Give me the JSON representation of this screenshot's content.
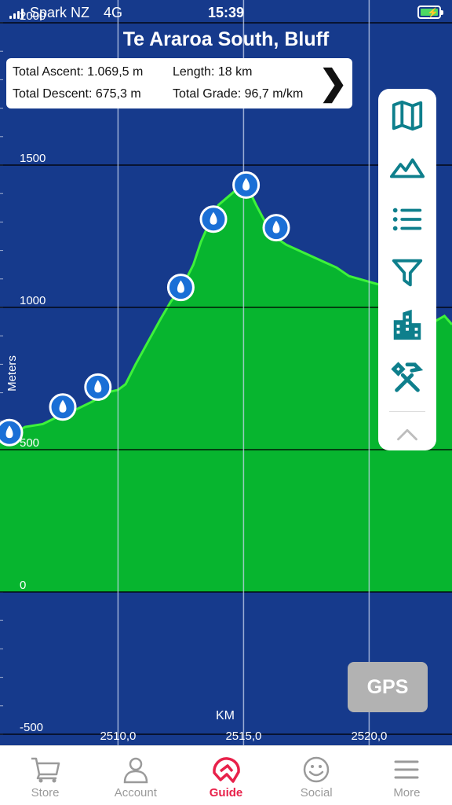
{
  "status": {
    "carrier": "Spark NZ",
    "network": "4G",
    "time": "15:39"
  },
  "title": "Te Araroa South, Bluff",
  "stats": {
    "ascent": "Total Ascent: 1.069,5 m",
    "length": "Length: 18 km",
    "descent": "Total Descent: 675,3 m",
    "grade": "Total Grade: 96,7 m/km",
    "more_icon": "chevron-right-icon"
  },
  "toolbar": {
    "items": [
      {
        "name": "map-icon"
      },
      {
        "name": "elevation-icon"
      },
      {
        "name": "list-icon"
      },
      {
        "name": "filter-icon"
      },
      {
        "name": "buildings-icon"
      },
      {
        "name": "tools-icon"
      },
      {
        "name": "collapse-icon"
      }
    ]
  },
  "gps_label": "GPS",
  "tabs": [
    {
      "label": "Store",
      "icon": "cart-icon"
    },
    {
      "label": "Account",
      "icon": "person-icon"
    },
    {
      "label": "Guide",
      "icon": "guide-icon",
      "active": true
    },
    {
      "label": "Social",
      "icon": "smiley-icon"
    },
    {
      "label": "More",
      "icon": "menu-icon"
    }
  ],
  "colors": {
    "background": "#163a8c",
    "fill": "#07b52f",
    "line": "#3ef23a",
    "accent": "#0e7f8c",
    "marker": "#1a6fd6",
    "active_tab": "#e8214a"
  },
  "chart_data": {
    "type": "area",
    "xlabel": "KM",
    "ylabel": "Meters",
    "ylim": [
      -500,
      2000
    ],
    "xlim": [
      2505.3,
      2523.3
    ],
    "yticks": [
      -500,
      0,
      500,
      1000,
      1500,
      2000
    ],
    "ytick_labels": [
      "-500",
      "0",
      "500",
      "1000",
      "1500",
      "2000"
    ],
    "xticks": [
      2510,
      2515,
      2520
    ],
    "xtick_labels": [
      "2510,0",
      "2515,0",
      "2520,0"
    ],
    "grid": true,
    "x": [
      2505.3,
      2505.7,
      2506.3,
      2507.0,
      2507.7,
      2508.3,
      2509.0,
      2509.5,
      2510.0,
      2510.3,
      2510.7,
      2511.2,
      2511.7,
      2512.1,
      2512.6,
      2513.0,
      2513.3,
      2513.6,
      2514.0,
      2514.4,
      2514.8,
      2515.2,
      2515.5,
      2515.8,
      2516.2,
      2516.7,
      2517.2,
      2517.7,
      2518.2,
      2518.7,
      2519.2,
      2519.6,
      2520.0,
      2520.4,
      2520.8,
      2521.2,
      2521.7,
      2522.2,
      2522.6,
      2523.0,
      2523.3
    ],
    "y": [
      540,
      550,
      580,
      590,
      620,
      640,
      670,
      700,
      710,
      730,
      800,
      880,
      960,
      1020,
      1080,
      1150,
      1230,
      1290,
      1360,
      1390,
      1420,
      1415,
      1360,
      1310,
      1250,
      1220,
      1200,
      1180,
      1160,
      1140,
      1110,
      1100,
      1090,
      1080,
      1050,
      1010,
      980,
      960,
      950,
      970,
      940
    ],
    "markers": [
      {
        "x": 2505.3,
        "y": 560
      },
      {
        "x": 2507.8,
        "y": 650
      },
      {
        "x": 2509.2,
        "y": 720
      },
      {
        "x": 2512.5,
        "y": 1070
      },
      {
        "x": 2513.8,
        "y": 1310
      },
      {
        "x": 2515.1,
        "y": 1430
      },
      {
        "x": 2516.3,
        "y": 1280
      }
    ]
  }
}
